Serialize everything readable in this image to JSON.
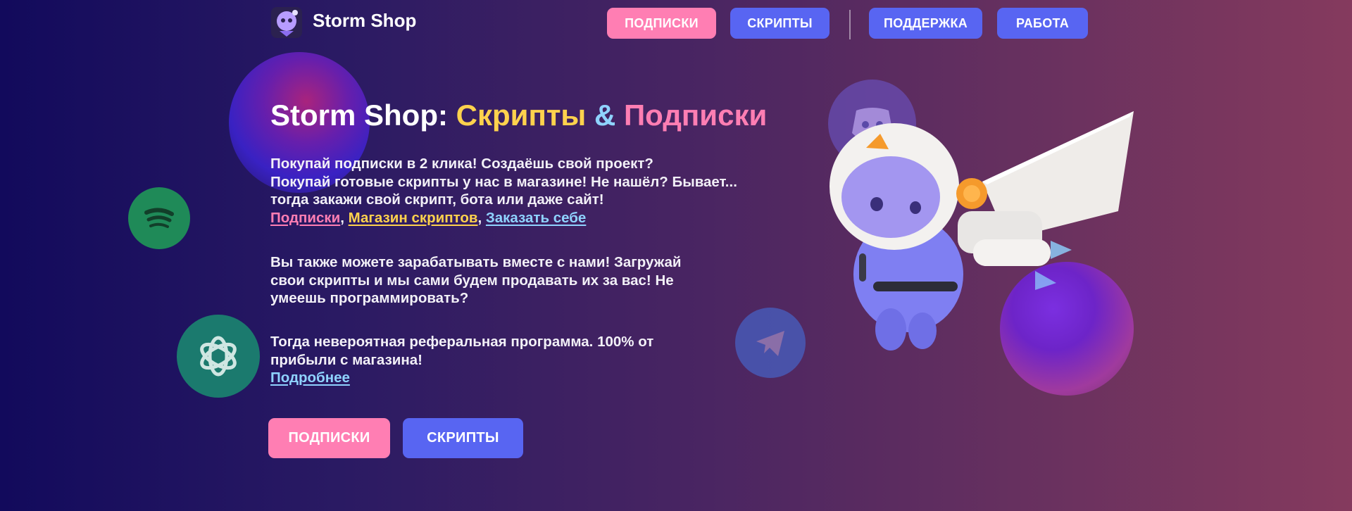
{
  "header": {
    "brand": "Storm Shop",
    "nav": {
      "subscriptions": "ПОДПИСКИ",
      "scripts": "СКРИПТЫ",
      "support": "ПОДДЕРЖКА",
      "work": "РАБОТА"
    }
  },
  "hero": {
    "title_part1": "Storm Shop: ",
    "title_scripts": "Скрипты",
    "title_amp": " & ",
    "title_subscriptions": "Подписки",
    "intro_lines": [
      "Покупай подписки в 2 клика! Создаёшь свой проект?",
      "Покупай готовые скрипты у нас в магазине! Не нашёл? Бывает...",
      "тогда закажи свой скрипт, бота или даже сайт!"
    ],
    "links": {
      "subscriptions": "Подписки",
      "sep1": ", ",
      "scripts_shop": "Магазин скриптов",
      "sep2": ", ",
      "order": "Заказать себе"
    },
    "earn_lines": [
      "Вы также можете зарабатывать вместе с нами! Загружай",
      "свои скрипты и мы сами будем продавать их за вас! Не",
      "умеешь программировать?"
    ],
    "referral_lines": [
      "Тогда невероятная реферальная программа. 100% от",
      "прибыли с магазина!"
    ],
    "more_link": "Подробнее",
    "cta": {
      "subscriptions": "ПОДПИСКИ",
      "scripts": "СКРИПТЫ"
    }
  },
  "icons": [
    "storm-shop-logo-icon",
    "spotify-icon",
    "openai-icon",
    "discord-icon",
    "telegram-icon",
    "astronaut-mascot-icon"
  ],
  "colors": {
    "accent_pink": "#ff7eb3",
    "accent_blue": "#5865f2",
    "accent_yellow": "#ffd24d",
    "accent_cyan": "#8fd3ff",
    "spotify": "#1f8a58",
    "openai": "#1b7a6e"
  }
}
